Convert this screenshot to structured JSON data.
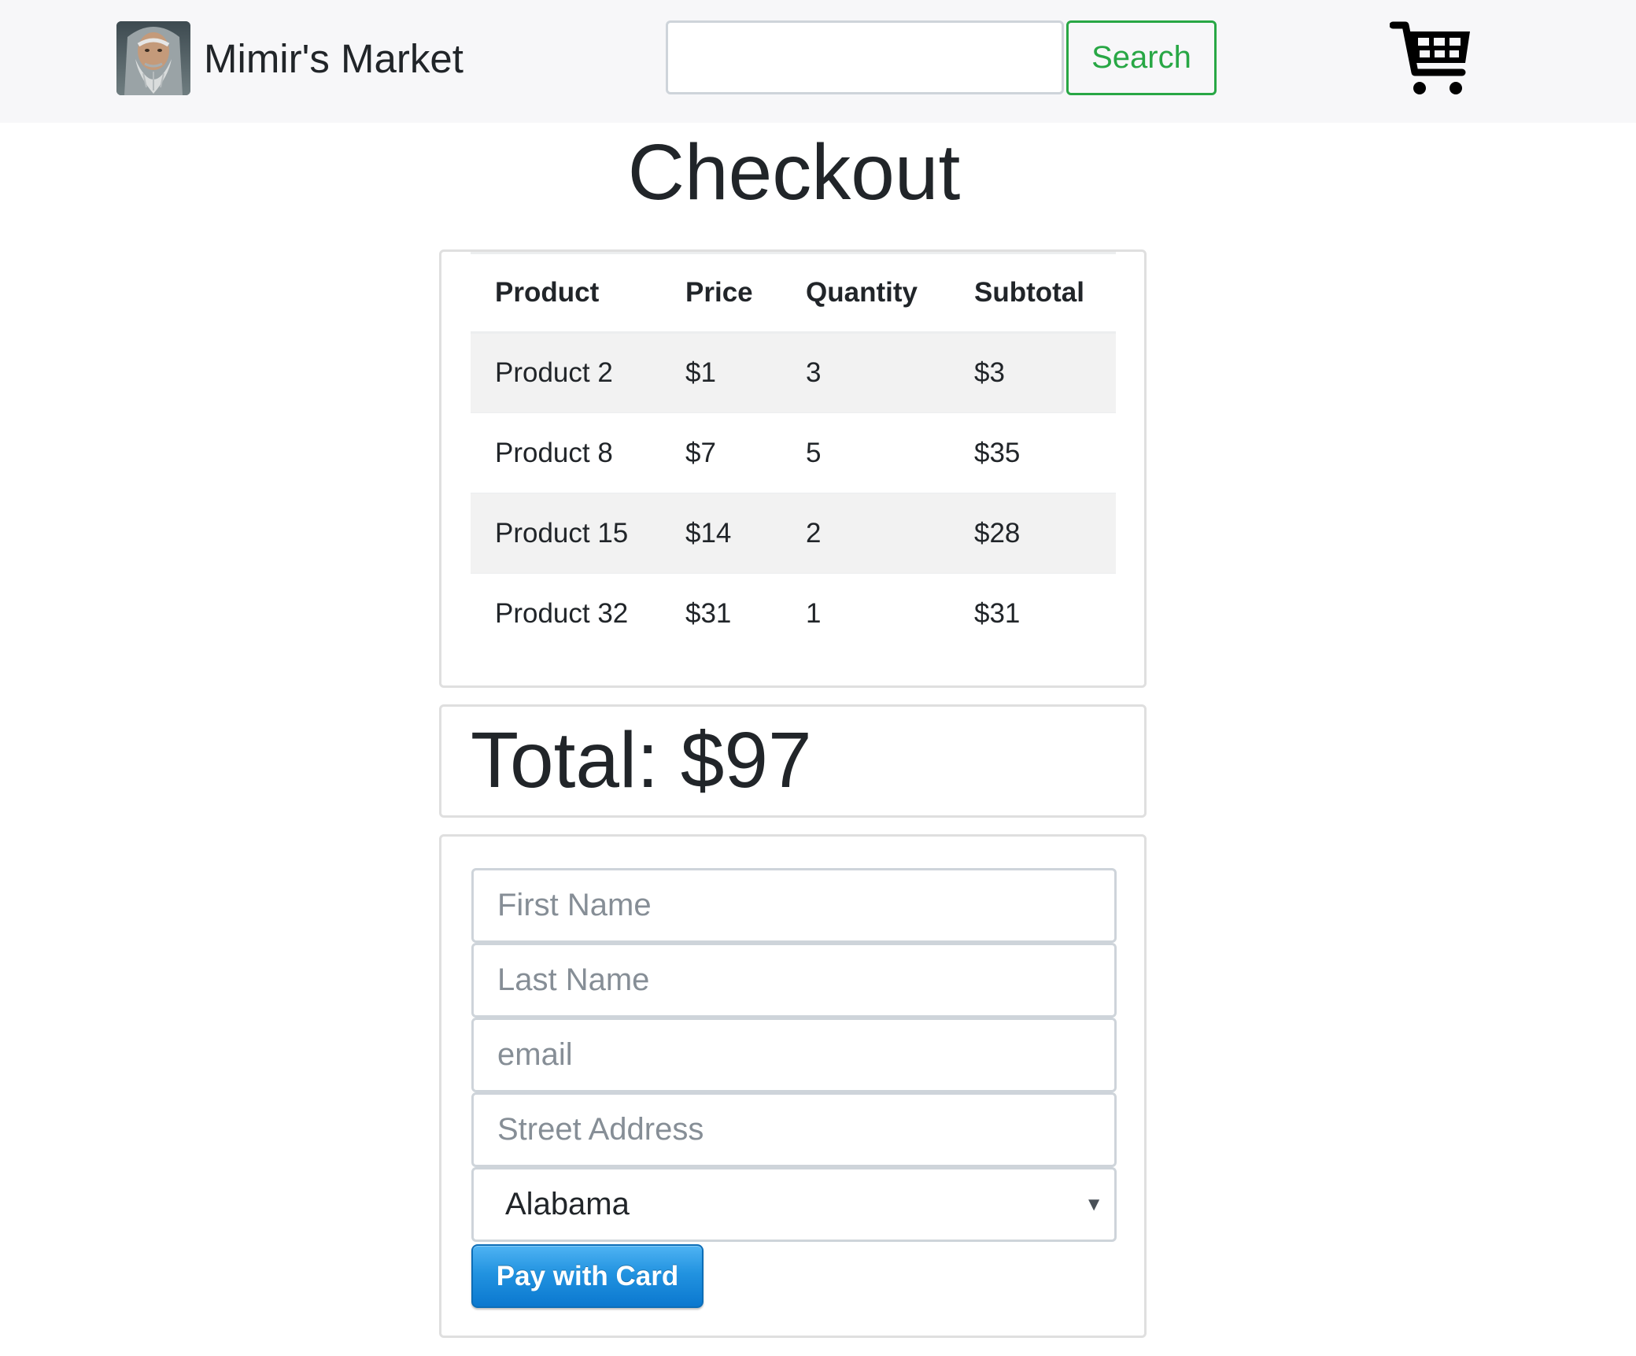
{
  "navbar": {
    "brand_name": "Mimir's Market",
    "search_value": "",
    "search_label": "Search"
  },
  "page": {
    "title": "Checkout"
  },
  "cart_table": {
    "headers": [
      "Product",
      "Price",
      "Quantity",
      "Subtotal"
    ],
    "rows": [
      [
        "Product 2",
        "$1",
        "3",
        "$3"
      ],
      [
        "Product 8",
        "$7",
        "5",
        "$35"
      ],
      [
        "Product 15",
        "$14",
        "2",
        "$28"
      ],
      [
        "Product 32",
        "$31",
        "1",
        "$31"
      ]
    ]
  },
  "total": {
    "text": "Total: $97"
  },
  "checkout_form": {
    "first_name_placeholder": "First Name",
    "last_name_placeholder": "Last Name",
    "email_placeholder": "email",
    "street_placeholder": "Street Address",
    "state_selected": "Alabama",
    "pay_label": "Pay with Card"
  },
  "colors": {
    "navbar_bg": "#f7f7f9",
    "search_accent": "#28a745",
    "pay_button": "#1a8fe0",
    "striped_row": "#f2f2f2"
  },
  "icons": {
    "brand": "bearded-sage-portrait",
    "cart": "shopping-cart-icon",
    "select_caret": "caret-down-icon"
  }
}
